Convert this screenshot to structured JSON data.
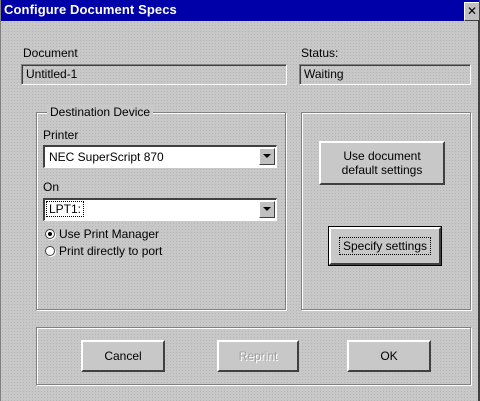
{
  "window": {
    "title": "Configure Document Specs",
    "close_glyph": "✕"
  },
  "document": {
    "label": "Document",
    "value": "Untitled-1"
  },
  "status": {
    "label": "Status:",
    "value": "Waiting"
  },
  "destination": {
    "group_label": "Destination Device",
    "printer_label": "Printer",
    "printer_value": "NEC SuperScript 870",
    "on_label": "On",
    "port_value": "LPT1:",
    "radio_options": [
      {
        "label": "Use Print Manager",
        "checked": true
      },
      {
        "label": "Print directly to port",
        "checked": false
      }
    ]
  },
  "settings": {
    "use_default_line1": "Use document",
    "use_default_line2": "default settings",
    "specify_label": "Specify settings"
  },
  "footer": {
    "cancel_label": "Cancel",
    "reprint_label": "Reprint",
    "reprint_enabled": false,
    "ok_label": "OK"
  },
  "icons": {
    "close": "close-icon",
    "dropdown": "chevron-down-icon"
  }
}
